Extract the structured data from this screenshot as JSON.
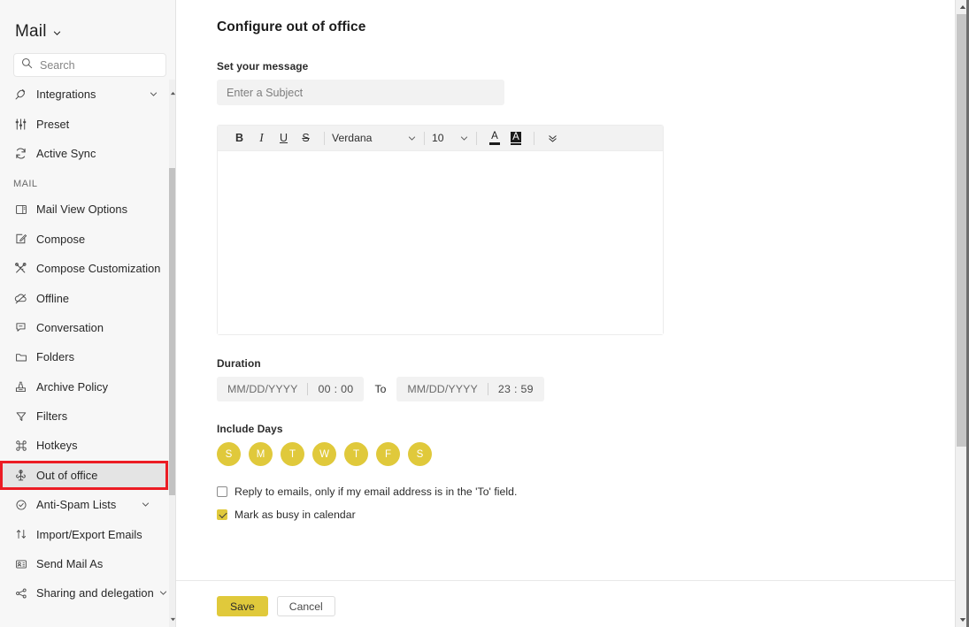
{
  "sidebar": {
    "title": "Mail",
    "title_caret_icon": "chevron-down-icon",
    "search": {
      "icon": "search-icon",
      "placeholder": "Search",
      "value": ""
    },
    "top_items": [
      {
        "label": "Integrations",
        "icon": "plug-icon",
        "has_chevron": true
      },
      {
        "label": "Preset",
        "icon": "sliders-icon",
        "has_chevron": false
      },
      {
        "label": "Active Sync",
        "icon": "sync-icon",
        "has_chevron": false
      }
    ],
    "group_title": "MAIL",
    "items": [
      {
        "label": "Mail View Options",
        "icon": "layout-panel-icon",
        "has_chevron": false
      },
      {
        "label": "Compose",
        "icon": "pencil-square-icon",
        "has_chevron": false
      },
      {
        "label": "Compose Customization",
        "icon": "scissors-wand-icon",
        "has_chevron": false
      },
      {
        "label": "Offline",
        "icon": "cloud-off-icon",
        "has_chevron": false
      },
      {
        "label": "Conversation",
        "icon": "chat-bubble-icon",
        "has_chevron": false
      },
      {
        "label": "Folders",
        "icon": "folder-icon",
        "has_chevron": false
      },
      {
        "label": "Archive Policy",
        "icon": "archive-box-icon",
        "has_chevron": false
      },
      {
        "label": "Filters",
        "icon": "funnel-icon",
        "has_chevron": false
      },
      {
        "label": "Hotkeys",
        "icon": "command-icon",
        "has_chevron": false
      },
      {
        "label": "Out of office",
        "icon": "out-of-office-icon",
        "has_chevron": false,
        "selected": true,
        "highlighted": true
      },
      {
        "label": "Anti-Spam Lists",
        "icon": "shield-check-icon",
        "has_chevron": true
      },
      {
        "label": "Import/Export Emails",
        "icon": "up-down-arrows-icon",
        "has_chevron": false
      },
      {
        "label": "Send Mail As",
        "icon": "identity-card-icon",
        "has_chevron": false
      },
      {
        "label": "Sharing and delegation",
        "icon": "share-nodes-icon",
        "has_chevron": true
      }
    ],
    "highlight_color": "#ec1c24",
    "selected_bg": "#e4e4e4"
  },
  "main": {
    "page_title": "Configure out of office",
    "message_section_label": "Set your message",
    "subject": {
      "placeholder": "Enter a Subject",
      "value": ""
    },
    "editor": {
      "bold_label": "B",
      "italic_label": "I",
      "underline_label": "U",
      "strikethrough_label": "S",
      "font_family_value": "Verdana",
      "font_size_value": "10",
      "font_family_caret_icon": "chevron-down-icon",
      "font_size_caret_icon": "chevron-down-icon",
      "text_color_glyph": "A",
      "highlight_color_glyph": "A",
      "more_options_icon": "double-chevron-down-icon",
      "body_value": ""
    },
    "duration": {
      "label": "Duration",
      "from": {
        "date_placeholder": "MM/DD/YYYY",
        "time_value": "00 : 00"
      },
      "to_text": "To",
      "until": {
        "date_placeholder": "MM/DD/YYYY",
        "time_value": "23 : 59"
      }
    },
    "include_days": {
      "label": "Include Days",
      "days": [
        {
          "letter": "S",
          "name": "sunday",
          "active": true
        },
        {
          "letter": "M",
          "name": "monday",
          "active": true
        },
        {
          "letter": "T",
          "name": "tuesday",
          "active": true
        },
        {
          "letter": "W",
          "name": "wednesday",
          "active": true
        },
        {
          "letter": "T",
          "name": "thursday",
          "active": true
        },
        {
          "letter": "F",
          "name": "friday",
          "active": true
        },
        {
          "letter": "S",
          "name": "saturday",
          "active": true
        }
      ],
      "active_color": "#e0c93b"
    },
    "options": [
      {
        "label": "Reply to emails, only if my email address is in the 'To' field.",
        "checked": false
      },
      {
        "label": "Mark as busy in calendar",
        "checked": true
      }
    ],
    "buttons": {
      "save_label": "Save",
      "cancel_label": "Cancel",
      "save_color": "#e0c93b"
    }
  },
  "scrollbars": {
    "sidebar_up_icon": "triangle-up-icon",
    "sidebar_down_icon": "triangle-down-icon",
    "page_up_icon": "triangle-up-icon",
    "page_down_icon": "triangle-down-icon"
  }
}
